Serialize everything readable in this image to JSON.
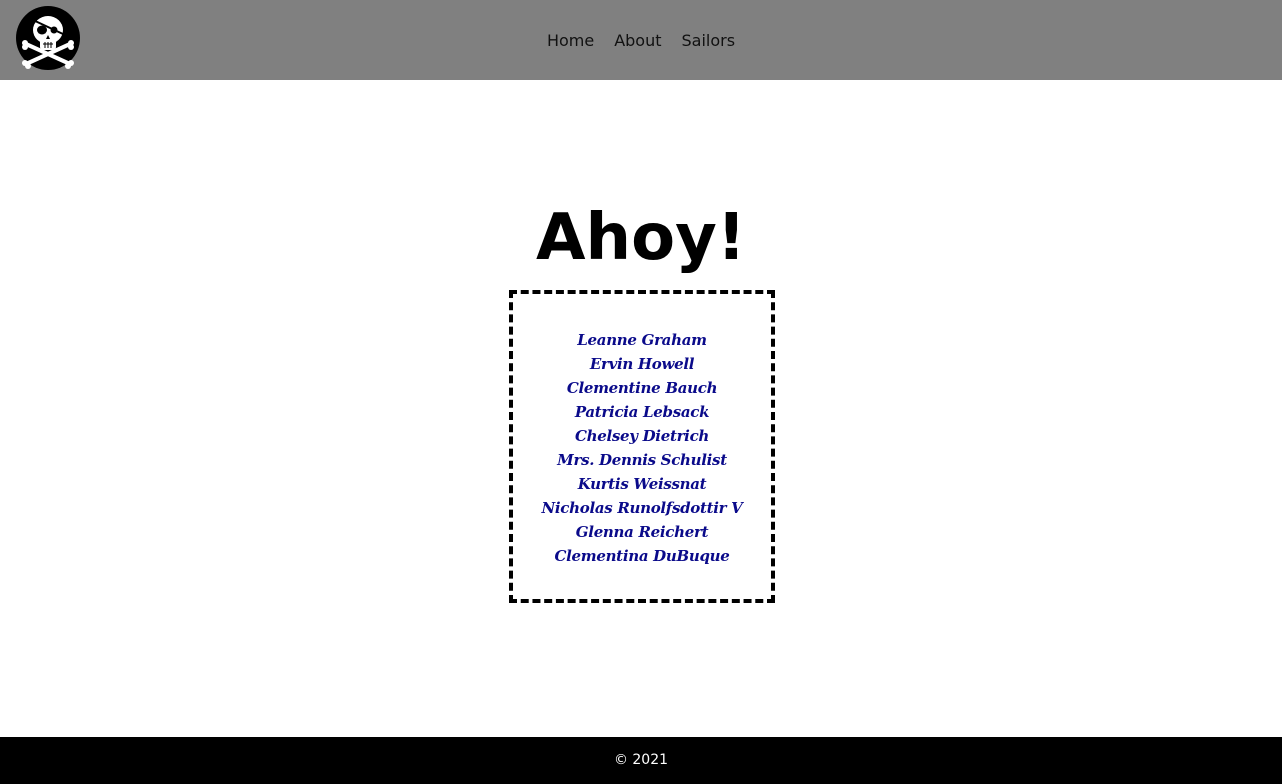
{
  "header": {
    "logo_icon": "jolly-roger-icon",
    "nav": [
      {
        "label": "Home"
      },
      {
        "label": "About"
      },
      {
        "label": "Sailors"
      }
    ]
  },
  "main": {
    "title": "Ahoy!",
    "sailors": [
      "Leanne Graham",
      "Ervin Howell",
      "Clementine Bauch",
      "Patricia Lebsack",
      "Chelsey Dietrich",
      "Mrs. Dennis Schulist",
      "Kurtis Weissnat",
      "Nicholas Runolfsdottir V",
      "Glenna Reichert",
      "Clementina DuBuque"
    ]
  },
  "footer": {
    "copyright": "© 2021"
  },
  "colors": {
    "header_bg": "#808080",
    "footer_bg": "#000000",
    "sailor_name": "#0a0a8a"
  }
}
